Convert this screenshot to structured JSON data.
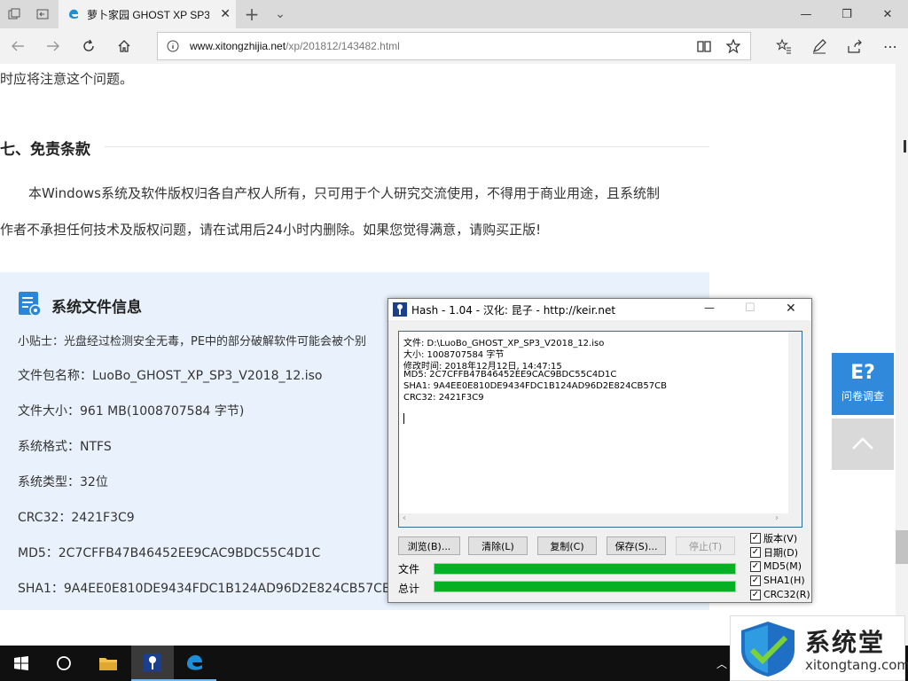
{
  "browser": {
    "tab_title": "萝卜家园 GHOST XP SP3",
    "tab_close": "✕",
    "new_tab": "+",
    "tab_list": "⌄",
    "minimize": "—",
    "restore": "❐",
    "close": "✕",
    "url_domain": "www.xitongzhijia.net",
    "url_path": "/xp/201812/143482.html"
  },
  "page": {
    "top_text": "时应将注意这个问题。",
    "section_title": "七、免责条款",
    "paragraph_line1": "本Windows系统及软件版权归各自产权人所有，只可用于个人研究交流使用，不得用于商业用途，且系统制",
    "paragraph_line2": "作者不承担任何技术及版权问题，请在试用后24小时内删除。如果您觉得满意，请购买正版!",
    "info_title": "系统文件信息",
    "tip": "小贴士：光盘经过检测安全无毒，PE中的部分破解软件可能会被个别",
    "filename": "文件包名称：LuoBo_GHOST_XP_SP3_V2018_12.iso",
    "filesize": "文件大小：961 MB(1008707584 字节)",
    "format": "系统格式：NTFS",
    "systype": "系统类型：32位",
    "crc32": "CRC32：2421F3C9",
    "md5": "MD5：2C7CFFB47B46452EE9CAC9BDC55C4D1C",
    "sha1": "SHA1：9A4EE0E810DE9434FDC1B124AD96D2E824CB57CB"
  },
  "side": {
    "survey_label": "问卷调查",
    "survey_glyph": "E?",
    "totop_glyph": "︿"
  },
  "dialog": {
    "title": "Hash - 1.04 - 汉化: 昆子 - http://keir.net",
    "close": "✕",
    "maximize": "☐",
    "minimize": "—",
    "lines": [
      "文件: D:\\LuoBo_GHOST_XP_SP3_V2018_12.iso",
      "大小: 1008707584 字节",
      "修改时间: 2018年12月12日, 14:47:15",
      "MD5: 2C7CFFB47B46452EE9CAC9BDC55C4D1C",
      "SHA1: 9A4EE0E810DE9434FDC1B124AD96D2E824CB57CB",
      "CRC32: 2421F3C9"
    ],
    "btn_browse": "浏览(B)...",
    "btn_clear": "清除(L)",
    "btn_copy": "复制(C)",
    "btn_save": "保存(S)...",
    "btn_stop": "停止(T)",
    "cb_version": "版本(V)",
    "cb_date": "日期(D)",
    "cb_md5": "MD5(M)",
    "cb_sha1": "SHA1(H)",
    "cb_crc32": "CRC32(R)",
    "check_mark": "✓",
    "progress_file_label": "文件",
    "progress_total_label": "总计",
    "progress_file": 1.0,
    "progress_total": 1.0
  },
  "watermark": {
    "brand": "系统堂",
    "domain": "xitongtang.com"
  },
  "colors": {
    "accent": "#3189dc",
    "progress": "#06b025"
  }
}
